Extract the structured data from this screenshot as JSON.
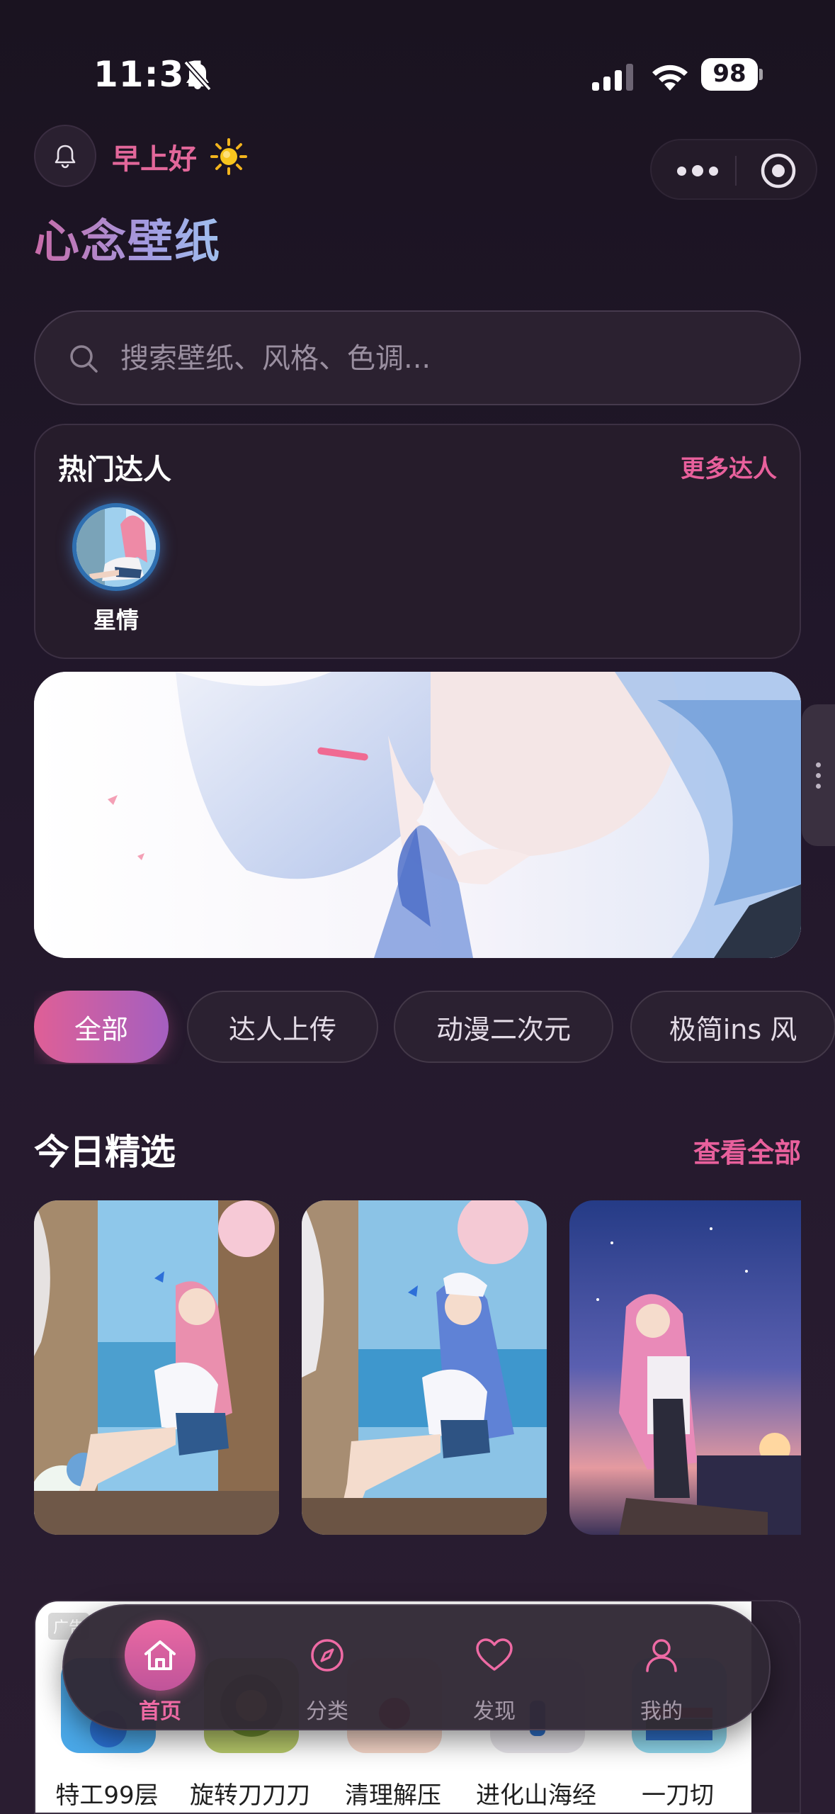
{
  "status_bar": {
    "time": "11:31",
    "battery": "98"
  },
  "header": {
    "greeting": "早上好",
    "app_title": "心念壁纸"
  },
  "search": {
    "placeholder": "搜索壁纸、风格、色调..."
  },
  "creators": {
    "title": "热门达人",
    "more_label": "更多达人",
    "items": [
      {
        "name": "星情"
      }
    ]
  },
  "categories": [
    {
      "label": "全部",
      "active": true
    },
    {
      "label": "达人上传",
      "active": false
    },
    {
      "label": "动漫二次元",
      "active": false
    },
    {
      "label": "极简ins 风",
      "active": false
    }
  ],
  "featured": {
    "title": "今日精选",
    "more_label": "查看全部"
  },
  "ad": {
    "badge": "广告",
    "games": [
      {
        "label": "特工99层"
      },
      {
        "label": "旋转刀刀刀"
      },
      {
        "label": "清理解压"
      },
      {
        "label": "进化山海经"
      },
      {
        "label": "一刀切"
      }
    ]
  },
  "tabs": [
    {
      "label": "首页",
      "icon": "home-icon",
      "active": true
    },
    {
      "label": "分类",
      "icon": "compass-icon",
      "active": false
    },
    {
      "label": "发现",
      "icon": "heart-icon",
      "active": false
    },
    {
      "label": "我的",
      "icon": "user-icon",
      "active": false
    }
  ],
  "colors": {
    "accent": "#e8609c",
    "background": "#1c1422",
    "tab_active": "#ee6aa4"
  }
}
